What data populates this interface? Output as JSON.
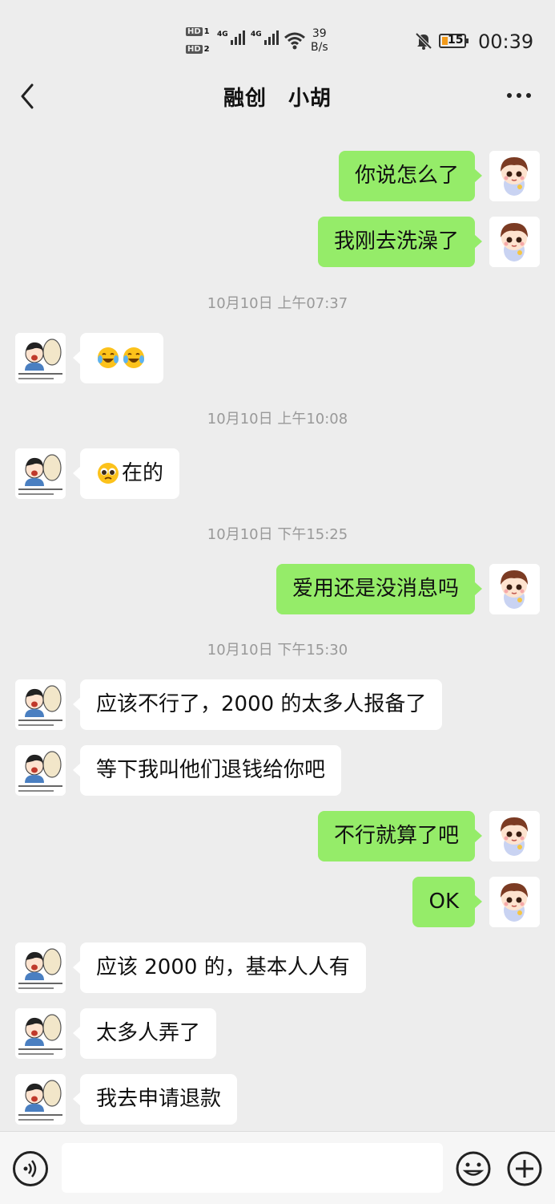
{
  "status_bar": {
    "sim1": "HD",
    "sim1_num": "1",
    "sim2": "HD",
    "sim2_num": "2",
    "net1": "4G",
    "net2": "4G",
    "speed_value": "39",
    "speed_unit": "B/s",
    "battery": "15",
    "time": "00:39",
    "colors": {
      "battery_fill": "#f29a1a"
    }
  },
  "header": {
    "title": "融创　小胡",
    "back_icon": "chevron-left-icon",
    "more_icon": "more-dots-icon"
  },
  "messages": [
    {
      "type": "msg",
      "side": "out",
      "text": "你说怎么了",
      "emoji": []
    },
    {
      "type": "msg",
      "side": "out",
      "text": "我刚去洗澡了",
      "emoji": []
    },
    {
      "type": "time",
      "text": "10月10日 上午07:37"
    },
    {
      "type": "msg",
      "side": "in",
      "text": "",
      "emoji": [
        "laugh-cry-emoji",
        "laugh-cry-emoji"
      ]
    },
    {
      "type": "time",
      "text": "10月10日 上午10:08"
    },
    {
      "type": "msg",
      "side": "in",
      "text": "在的",
      "emoji": [
        "pleading-emoji"
      ]
    },
    {
      "type": "time",
      "text": "10月10日 下午15:25"
    },
    {
      "type": "msg",
      "side": "out",
      "text": "爱用还是没消息吗",
      "emoji": []
    },
    {
      "type": "time",
      "text": "10月10日 下午15:30"
    },
    {
      "type": "msg",
      "side": "in",
      "text": "应该不行了，2000 的太多人报备了",
      "emoji": []
    },
    {
      "type": "msg",
      "side": "in",
      "text": "等下我叫他们退钱给你吧",
      "emoji": []
    },
    {
      "type": "msg",
      "side": "out",
      "text": "不行就算了吧",
      "emoji": []
    },
    {
      "type": "msg",
      "side": "out",
      "text": "OK",
      "emoji": []
    },
    {
      "type": "msg",
      "side": "in",
      "text": "应该 2000 的，基本人人有",
      "emoji": []
    },
    {
      "type": "msg",
      "side": "in",
      "text": "太多人弄了",
      "emoji": []
    },
    {
      "type": "msg",
      "side": "in",
      "text": "我去申请退款",
      "emoji": []
    }
  ],
  "avatars": {
    "in": "cartoon-man-drum-avatar",
    "out": "cartoon-boy-avatar"
  },
  "input_bar": {
    "placeholder": "",
    "voice_icon": "voice-icon",
    "emoji_icon": "emoji-face-icon",
    "plus_icon": "plus-circle-icon"
  },
  "colors": {
    "background": "#ededed",
    "bubble_out": "#95ec69",
    "bubble_in": "#ffffff",
    "timestamp": "#999999"
  }
}
